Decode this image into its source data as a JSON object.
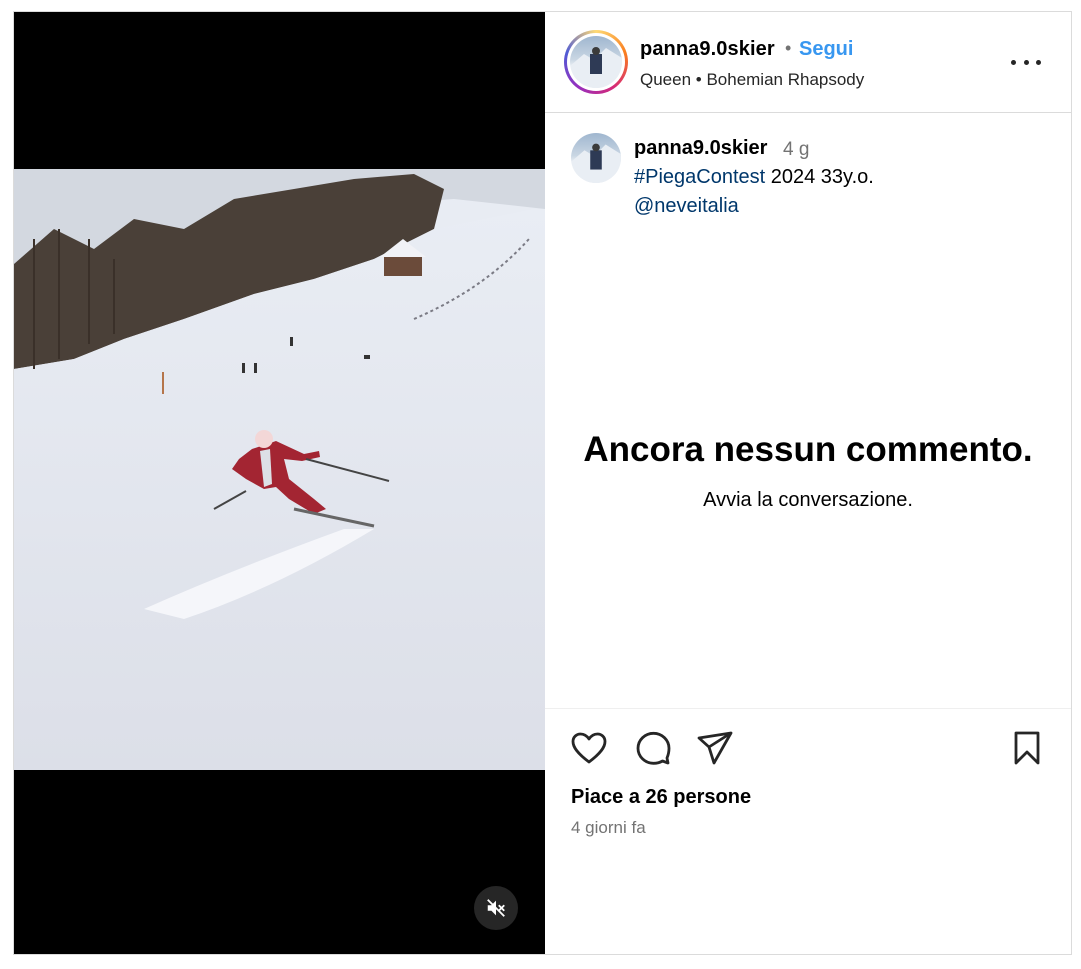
{
  "post": {
    "media": {
      "mute_icon": "speaker-muted-icon"
    },
    "header": {
      "username": "panna9.0skier",
      "separator": "•",
      "follow_label": "Segui",
      "song": "Queen • Bohemian Rhapsody",
      "more_icon": "more-horizontal-icon"
    },
    "caption": {
      "username": "panna9.0skier",
      "time": "4 g",
      "hashtag": "#PiegaContest",
      "text": " 2024 33y.o.",
      "mention": "@neveitalia"
    },
    "comments": {
      "empty_title": "Ancora nessun commento.",
      "empty_subtitle": "Avvia la conversazione."
    },
    "actions": {
      "like_icon": "heart-icon",
      "comment_icon": "comment-icon",
      "share_icon": "send-icon",
      "save_icon": "bookmark-icon"
    },
    "likes_text": "Piace a 26 persone",
    "posted_ago": "4 giorni fa",
    "colors": {
      "follow": "#3897f0",
      "link": "#00376b",
      "muted_text": "#737373"
    }
  }
}
